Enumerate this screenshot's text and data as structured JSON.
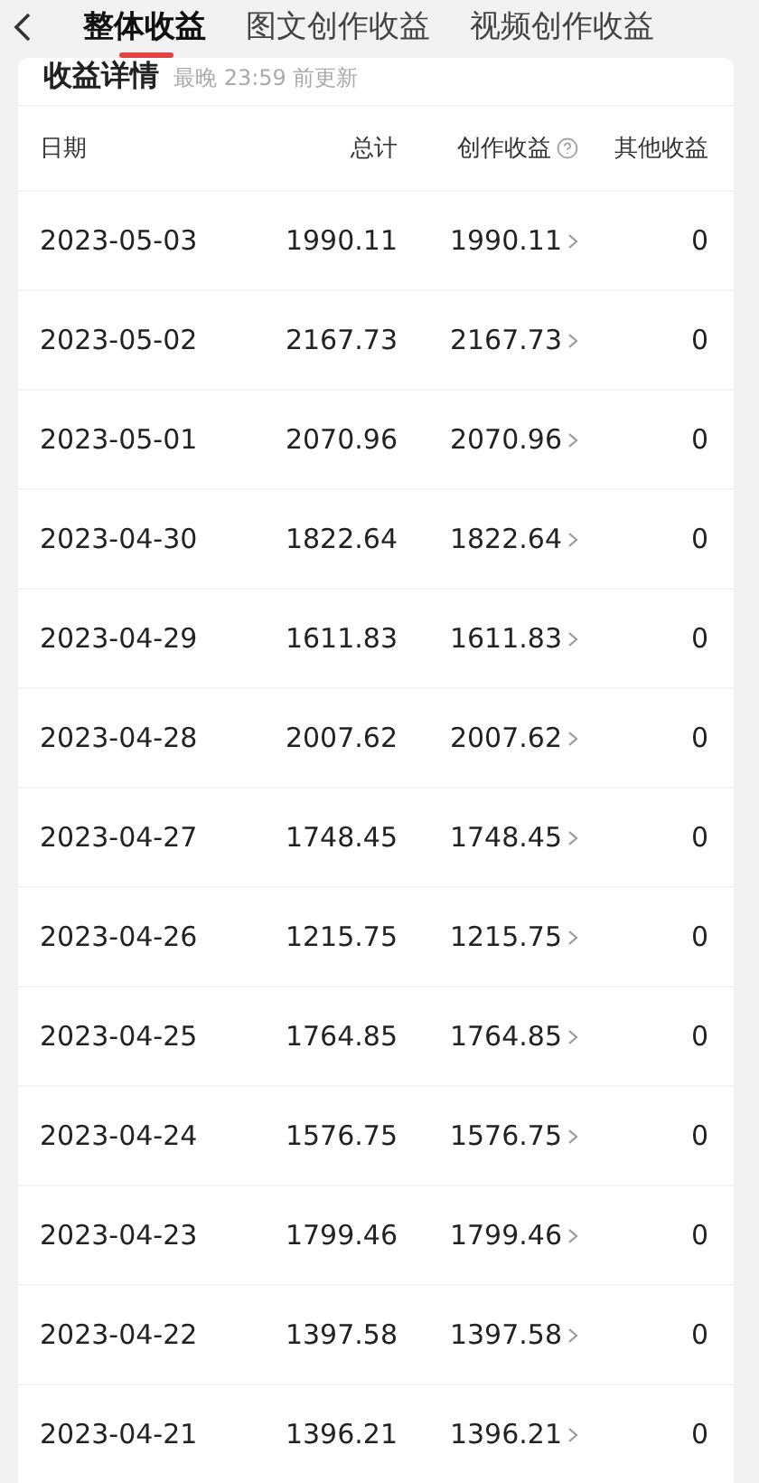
{
  "tabs": [
    {
      "label": "整体收益",
      "selected": true
    },
    {
      "label": "图文创作收益",
      "selected": false
    },
    {
      "label": "视频创作收益",
      "selected": false
    }
  ],
  "card": {
    "title": "收益详情",
    "subtitle": "最晚 23:59 前更新"
  },
  "table": {
    "columns": [
      "日期",
      "总计",
      "创作收益",
      "其他收益"
    ],
    "rows": [
      {
        "date": "2023-05-03",
        "total": "1990.11",
        "creation": "1990.11",
        "other": "0"
      },
      {
        "date": "2023-05-02",
        "total": "2167.73",
        "creation": "2167.73",
        "other": "0"
      },
      {
        "date": "2023-05-01",
        "total": "2070.96",
        "creation": "2070.96",
        "other": "0"
      },
      {
        "date": "2023-04-30",
        "total": "1822.64",
        "creation": "1822.64",
        "other": "0"
      },
      {
        "date": "2023-04-29",
        "total": "1611.83",
        "creation": "1611.83",
        "other": "0"
      },
      {
        "date": "2023-04-28",
        "total": "2007.62",
        "creation": "2007.62",
        "other": "0"
      },
      {
        "date": "2023-04-27",
        "total": "1748.45",
        "creation": "1748.45",
        "other": "0"
      },
      {
        "date": "2023-04-26",
        "total": "1215.75",
        "creation": "1215.75",
        "other": "0"
      },
      {
        "date": "2023-04-25",
        "total": "1764.85",
        "creation": "1764.85",
        "other": "0"
      },
      {
        "date": "2023-04-24",
        "total": "1576.75",
        "creation": "1576.75",
        "other": "0"
      },
      {
        "date": "2023-04-23",
        "total": "1799.46",
        "creation": "1799.46",
        "other": "0"
      },
      {
        "date": "2023-04-22",
        "total": "1397.58",
        "creation": "1397.58",
        "other": "0"
      },
      {
        "date": "2023-04-21",
        "total": "1396.21",
        "creation": "1396.21",
        "other": "0"
      }
    ]
  }
}
